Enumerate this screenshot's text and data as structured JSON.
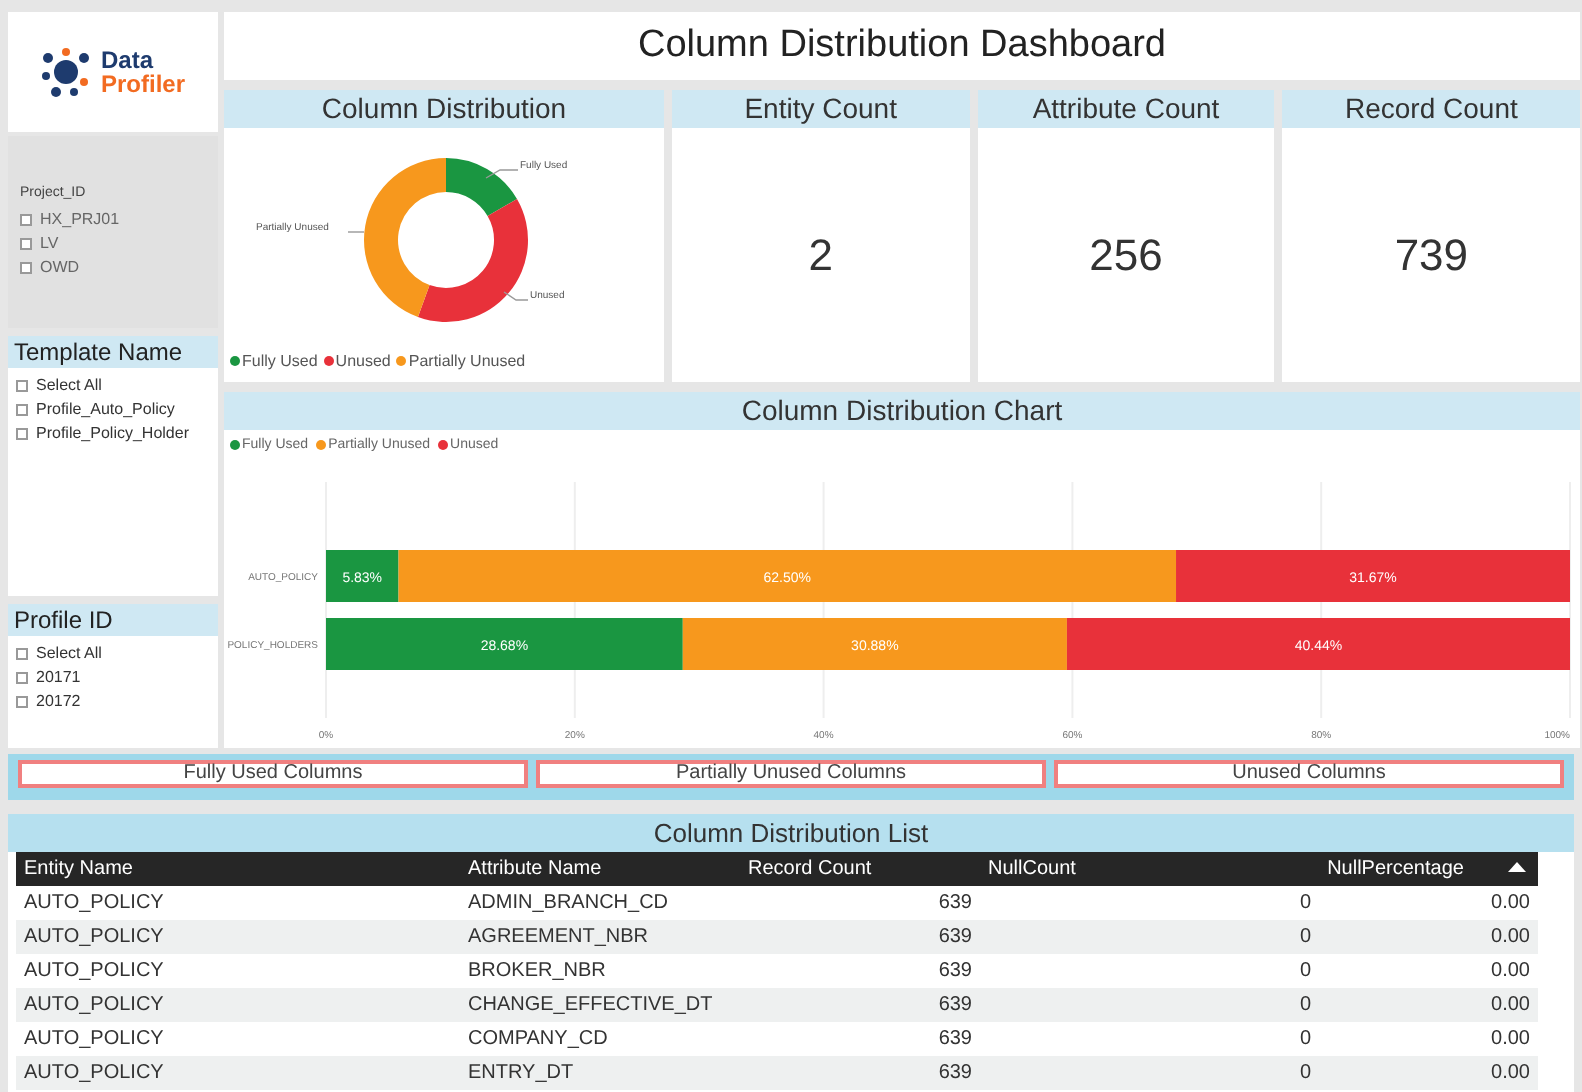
{
  "logo": {
    "line_1": "Data",
    "line_2": "Profiler"
  },
  "title": "Column Distribution Dashboard",
  "filters": [
    {
      "title": "Project_ID",
      "items": [
        {
          "label": "HX_PRJ01",
          "checked": false
        },
        {
          "label": "LV",
          "checked": false
        },
        {
          "label": "OWD",
          "checked": false
        }
      ]
    },
    {
      "title": "Template Name",
      "items": [
        {
          "label": "Select All",
          "checked": false
        },
        {
          "label": "Profile_Auto_Policy",
          "checked": false
        },
        {
          "label": "Profile_Policy_Holder",
          "checked": false
        }
      ]
    },
    {
      "title": "Profile ID",
      "items": [
        {
          "label": "Select All",
          "checked": false
        },
        {
          "label": "20171",
          "checked": false
        },
        {
          "label": "20172",
          "checked": false
        }
      ]
    }
  ],
  "donut_card": {
    "title": "Column Distribution",
    "slice_labels": [
      "Fully Used",
      "Unused",
      "Partially Unused"
    ],
    "legend": [
      {
        "label": "Fully Used",
        "color": "#1a9641"
      },
      {
        "label": "Unused",
        "color": "#e8313a"
      },
      {
        "label": "Partially Unused",
        "color": "#f7981d"
      }
    ]
  },
  "kpis": [
    {
      "title": "Entity Count",
      "value": "2"
    },
    {
      "title": "Attribute Count",
      "value": "256"
    },
    {
      "title": "Record Count",
      "value": "739"
    }
  ],
  "bar_card": {
    "title": "Column Distribution Chart",
    "chart_data": {
      "type": "bar",
      "orientation": "horizontal",
      "stacked": true,
      "grid": true,
      "categories": [
        "AUTO_POLICY",
        "POLICY_HOLDERS"
      ],
      "series": [
        {
          "name": "Fully Used",
          "color": "#1a9641",
          "values": [
            5.83,
            28.68
          ]
        },
        {
          "name": "Partially Unused",
          "color": "#f7981d",
          "values": [
            62.5,
            30.88
          ]
        },
        {
          "name": "Unused",
          "color": "#e8313a",
          "values": [
            31.67,
            40.44
          ]
        }
      ],
      "value_labels": [
        [
          "5.83%",
          "28.68%"
        ],
        [
          "62.50%",
          "30.88%"
        ],
        [
          "31.67%",
          "40.44%"
        ]
      ],
      "xlim": [
        0,
        100
      ],
      "xticks": [
        {
          "value": 0,
          "label": "0%"
        },
        {
          "value": 20,
          "label": "20%"
        },
        {
          "value": 40,
          "label": "40%"
        },
        {
          "value": 60,
          "label": "60%"
        },
        {
          "value": 80,
          "label": "80%"
        },
        {
          "value": 100,
          "label": "100%"
        }
      ]
    }
  },
  "buttons": [
    "Fully Used Columns",
    "Partially Unused Columns",
    "Unused Columns"
  ],
  "list": {
    "title": "Column Distribution List",
    "columns": [
      "Entity Name",
      "Attribute Name",
      "Record Count",
      "NullCount",
      "NullPercentage"
    ],
    "rows": [
      [
        "AUTO_POLICY",
        "ADMIN_BRANCH_CD",
        "639",
        "0",
        "0.00"
      ],
      [
        "AUTO_POLICY",
        "AGREEMENT_NBR",
        "639",
        "0",
        "0.00"
      ],
      [
        "AUTO_POLICY",
        "BROKER_NBR",
        "639",
        "0",
        "0.00"
      ],
      [
        "AUTO_POLICY",
        "CHANGE_EFFECTIVE_DT",
        "639",
        "0",
        "0.00"
      ],
      [
        "AUTO_POLICY",
        "COMPANY_CD",
        "639",
        "0",
        "0.00"
      ],
      [
        "AUTO_POLICY",
        "ENTRY_DT",
        "639",
        "0",
        "0.00"
      ]
    ]
  }
}
